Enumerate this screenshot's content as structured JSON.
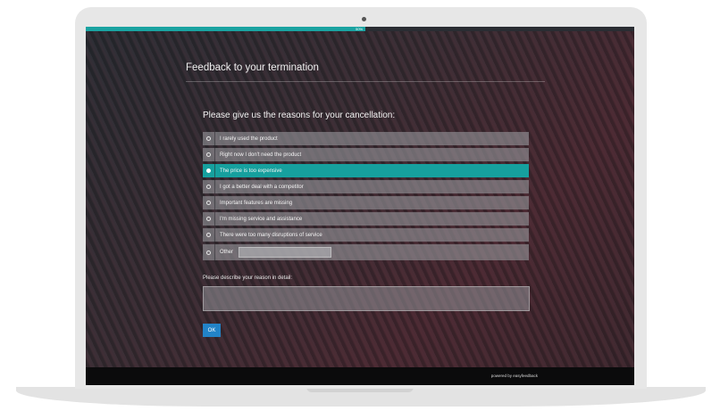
{
  "progress": {
    "percent": 50,
    "label": "50%"
  },
  "survey": {
    "title": "Feedback to your termination",
    "question": "Please give us the reasons for your cancellation:",
    "options": [
      {
        "label": "I rarely used the product",
        "selected": false
      },
      {
        "label": "Right now I don't need the product",
        "selected": false
      },
      {
        "label": "The price is too expensive",
        "selected": true
      },
      {
        "label": "I got a better deal with a competitor",
        "selected": false
      },
      {
        "label": "Important features are missing",
        "selected": false
      },
      {
        "label": "I'm missing service and assistance",
        "selected": false
      },
      {
        "label": "There were too many disruptions of service",
        "selected": false
      }
    ],
    "other_label": "Other",
    "other_value": "",
    "detail_label": "Please describe your reason in detail:",
    "detail_value": "",
    "ok_label": "OK"
  },
  "footer": {
    "powered_by": "powered by easyfeedback"
  },
  "colors": {
    "accent": "#16a09e",
    "button": "#2283c7",
    "footer": "#0b0b0c"
  }
}
